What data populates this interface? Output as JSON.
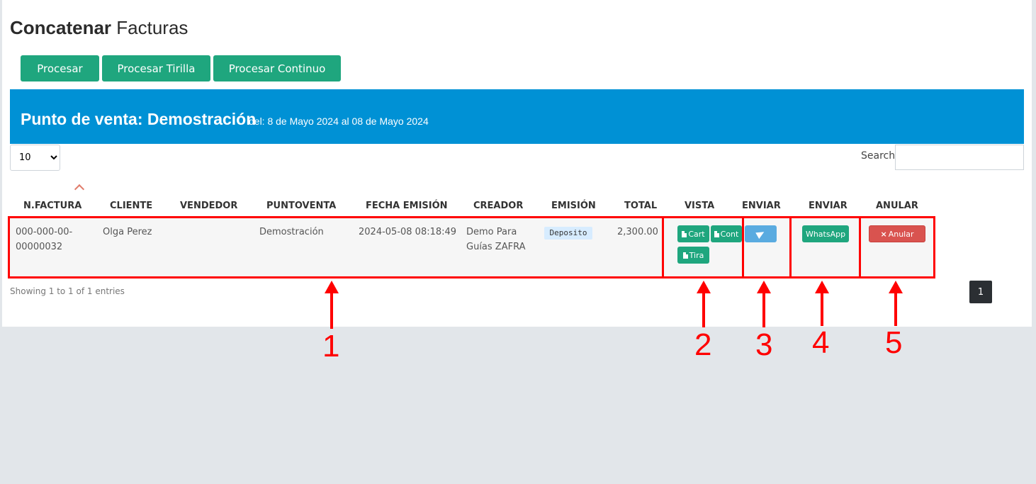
{
  "page": {
    "title_strong": "Concatenar",
    "title_rest": "Facturas"
  },
  "toolbar": {
    "procesar": "Procesar",
    "procesar_tirilla": "Procesar Tirilla",
    "procesar_continuo": "Procesar Continuo"
  },
  "banner": {
    "title": "Punto de venta: Demostración",
    "range": "del: 8 de Mayo 2024 al 08 de Mayo 2024"
  },
  "table_controls": {
    "page_length": "10",
    "search_label": "Search:"
  },
  "columns": [
    "N.FACTURA",
    "CLIENTE",
    "VENDEDOR",
    "PUNTOVENTA",
    "FECHA EMISIÓN",
    "CREADOR",
    "EMISIÓN",
    "TOTAL",
    "VISTA",
    "ENVIAR",
    "ENVIAR",
    "ANULAR"
  ],
  "rows": [
    {
      "factura_l1": "000-000-00-",
      "factura_l2": "00000032",
      "cliente": "Olga Perez",
      "vendedor": "",
      "puntoventa": "Demostración",
      "fecha": "2024-05-08 08:18:49",
      "creador_l1": "Demo Para",
      "creador_l2": "Guías ZAFRA",
      "emision": "Deposito",
      "total": "2,300.00",
      "btn_cart": "Cart",
      "btn_cont": "Cont",
      "btn_tira": "Tira",
      "btn_whatsapp": "WhatsApp",
      "btn_anular": "Anular"
    }
  ],
  "footer": {
    "showing": "Showing 1 to 1 of 1 entries",
    "current_page": "1"
  },
  "annotations": [
    "1",
    "2",
    "3",
    "4",
    "5"
  ],
  "colors": {
    "accent_green": "#1fa67e",
    "banner_blue": "#0091d5",
    "annotation_red": "#ff0000"
  }
}
